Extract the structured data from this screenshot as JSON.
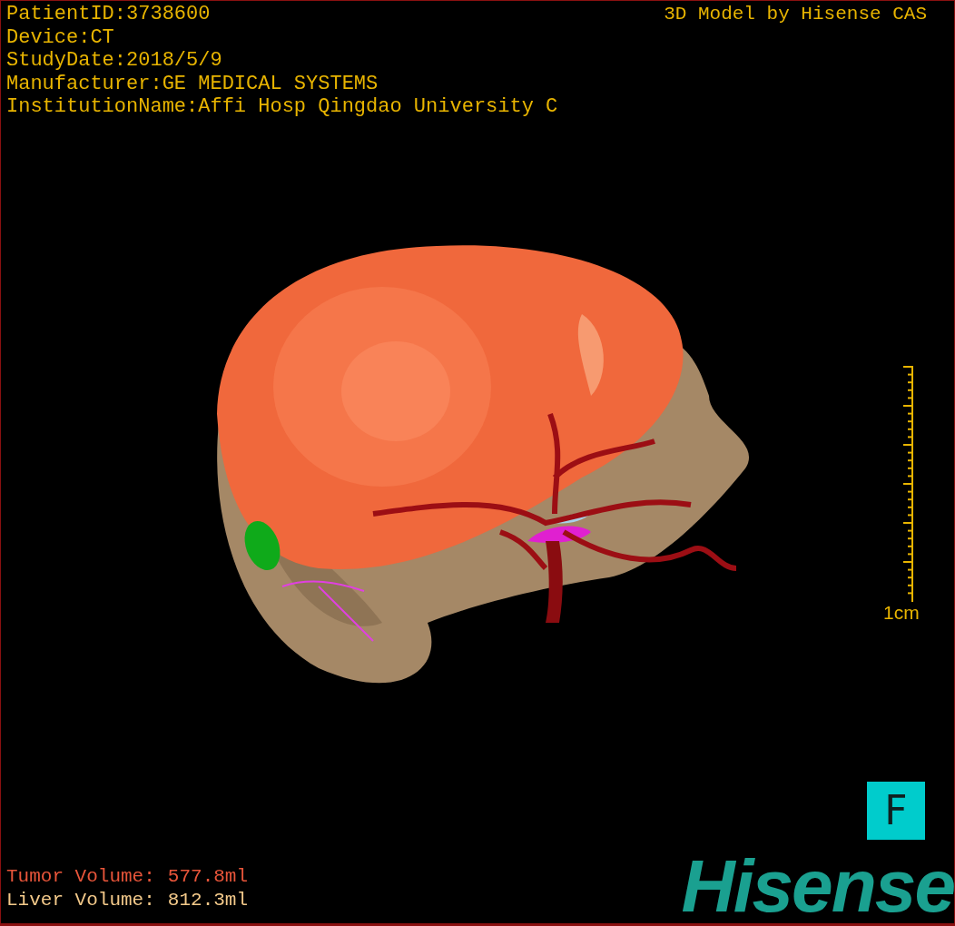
{
  "header": {
    "info": [
      "PatientID:3738600",
      "Device:CT",
      "StudyDate:2018/5/9",
      "Manufacturer:GE MEDICAL SYSTEMS",
      "InstitutionName:Affi Hosp Qingdao University C"
    ],
    "credit": "3D Model by Hisense CAS"
  },
  "scale_bar": {
    "label": "1cm"
  },
  "orientation_marker": {
    "label": "F"
  },
  "volumes": [
    {
      "label": "Tumor Volume:",
      "value": "577.8ml",
      "color": "#e8553a"
    },
    {
      "label": "Liver Volume:",
      "value": "812.3ml",
      "color": "#f3c98a"
    }
  ],
  "logo": {
    "text": "Hisense"
  }
}
